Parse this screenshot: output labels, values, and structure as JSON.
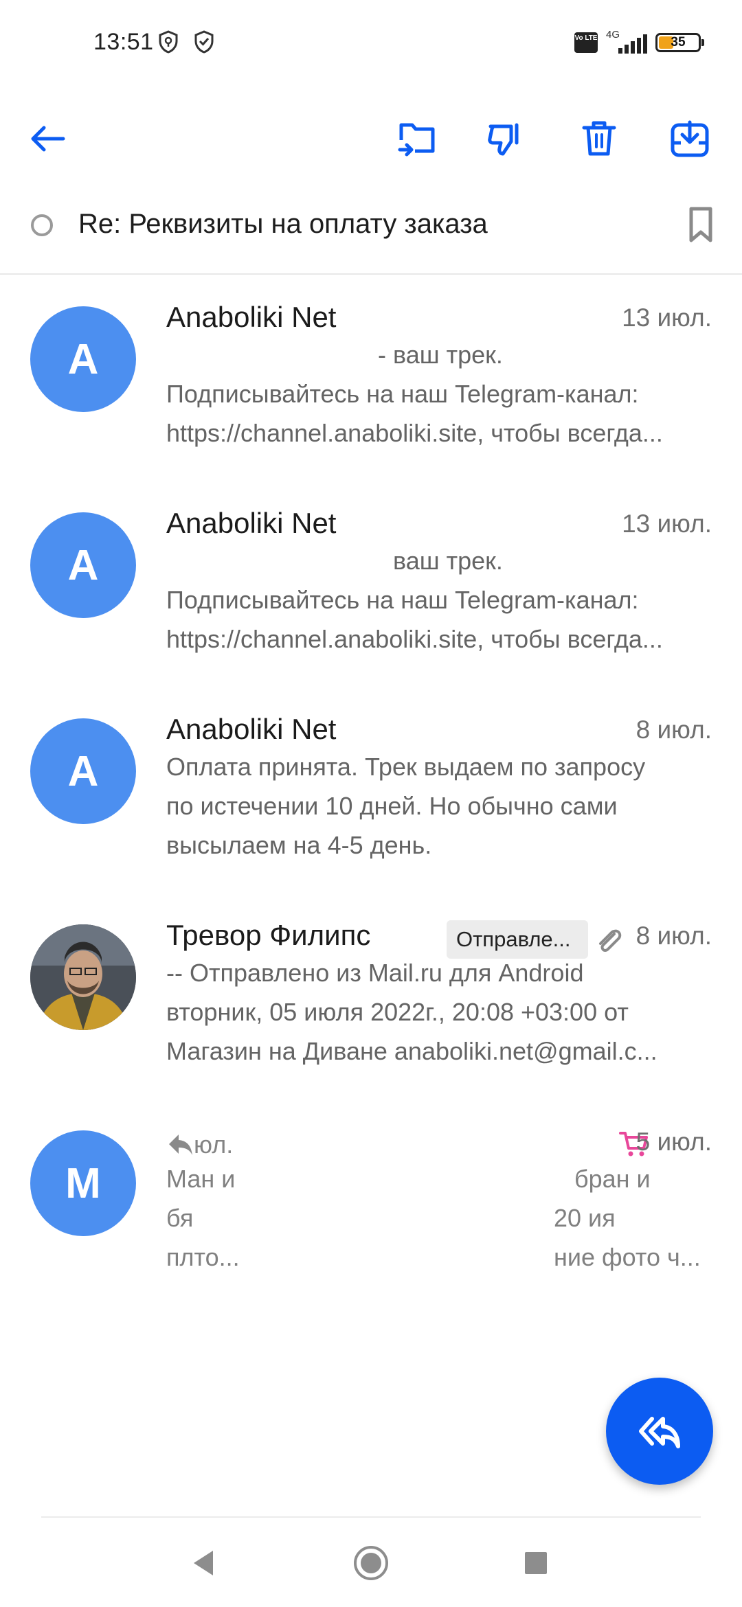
{
  "status_bar": {
    "time": "13:51",
    "network": "4G",
    "volte": "Vo LTE",
    "battery_level": "35",
    "battery_fraction": 0.35
  },
  "toolbar": {
    "icons": [
      "back-arrow-icon",
      "move-to-folder-icon",
      "spam-thumbs-down-icon",
      "trash-icon",
      "download-icon"
    ]
  },
  "thread": {
    "subject": "Re: Реквизиты на оплату заказа"
  },
  "messages": [
    {
      "avatar_letter": "A",
      "sender": "Anaboliki Net",
      "date": "13 июл.",
      "lines": [
        "- ваш трек.",
        "Подписывайтесь на наш Telegram-канал:",
        "https://channel.anaboliki.site, чтобы всегда..."
      ]
    },
    {
      "avatar_letter": "A",
      "sender": "Anaboliki Net",
      "date": "13 июл.",
      "lines": [
        "ваш трек.",
        "Подписывайтесь на наш Telegram-канал:",
        "https://channel.anaboliki.site, чтобы всегда..."
      ]
    },
    {
      "avatar_letter": "A",
      "sender": "Anaboliki Net",
      "date": "8 июл.",
      "lines": [
        "Оплата принята. Трек выдаем по запросу",
        "по истечении 10 дней. Но обычно сами",
        "высылаем на 4-5 день."
      ]
    },
    {
      "avatar_letter": "",
      "sender": "Тревор Филипс",
      "badge": "Отправле...",
      "date": "8 июл.",
      "lines": [
        "-- Отправлено из Mail.ru для Android",
        "вторник, 05 июля 2022г., 20:08 +03:00 от",
        "Магазин на Диване anaboliki.net@gmail.c..."
      ]
    },
    {
      "avatar_letter": "M",
      "sender_fragment": "юл.",
      "date": "5 июл.",
      "left_fragments": [
        "Ман и",
        "бя",
        "плто..."
      ],
      "right_fragments": [
        "бран и",
        "20 ия",
        "ние фото ч..."
      ]
    }
  ],
  "colors": {
    "accent": "#0c5cf2",
    "avatar_blue": "#4c8ff0",
    "cart_pink": "#e8479a"
  }
}
